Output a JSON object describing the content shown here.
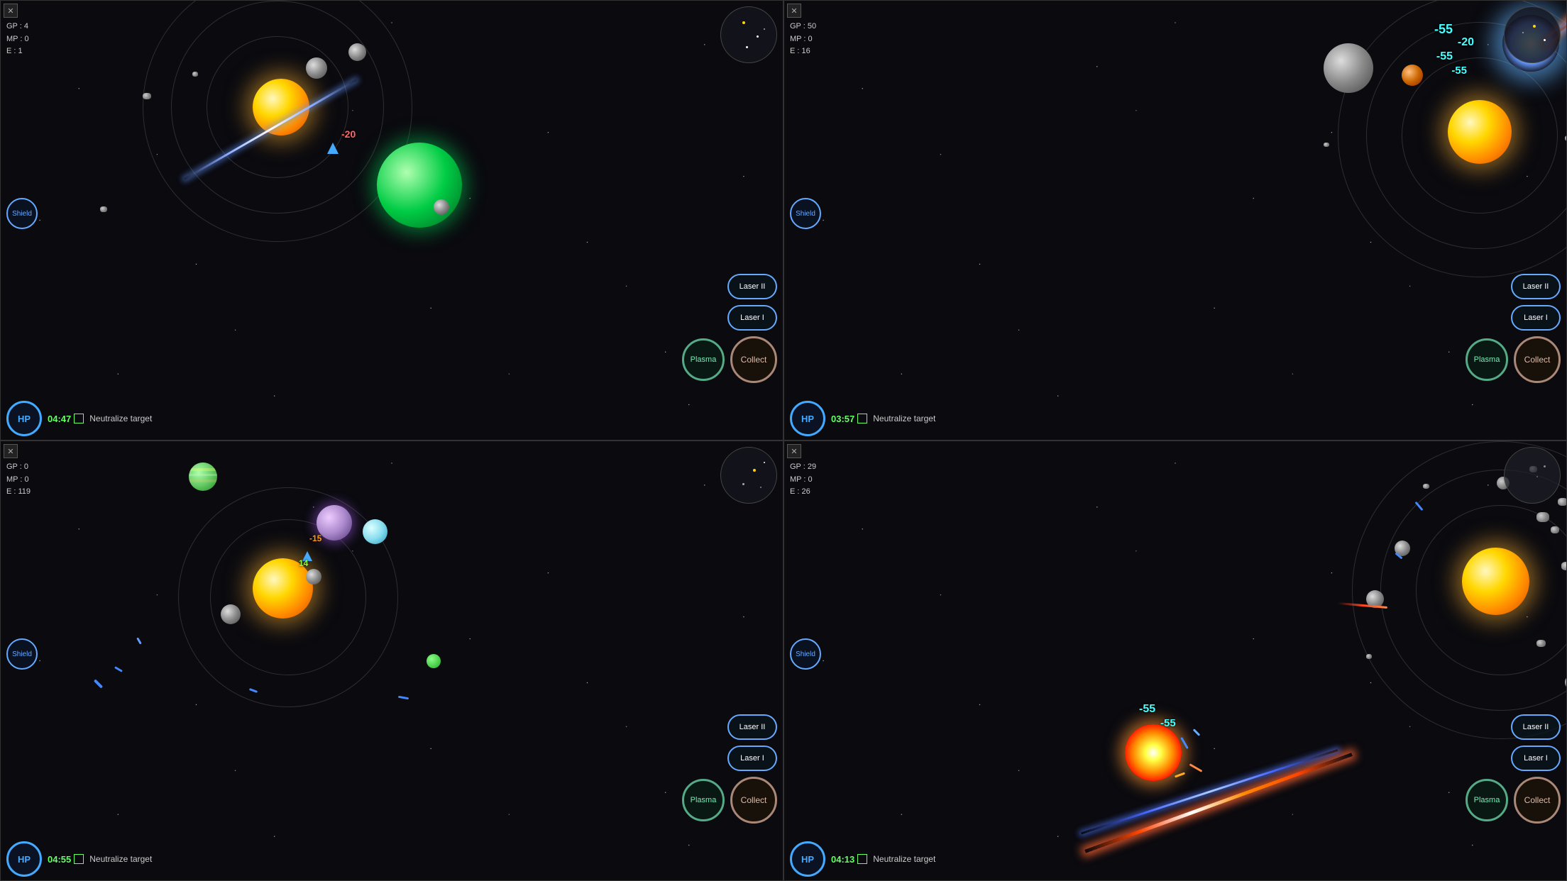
{
  "panels": [
    {
      "id": "panel-tl",
      "position": "top-left",
      "stats": {
        "gp": "GP : 4",
        "mp": "MP : 0",
        "e": "E : 1"
      },
      "timer": "04:47",
      "objective": "Neutralize target",
      "hp_label": "HP",
      "shield_label": "Shield",
      "buttons": {
        "laser2": "Laser II",
        "laser1": "Laser I",
        "plasma": "Plasma",
        "collect": "Collect"
      }
    },
    {
      "id": "panel-tr",
      "position": "top-right",
      "stats": {
        "gp": "GP : 50",
        "mp": "MP : 0",
        "e": "E : 16"
      },
      "timer": "03:57",
      "objective": "Neutralize target",
      "hp_label": "HP",
      "shield_label": "Shield",
      "buttons": {
        "laser2": "Laser II",
        "laser1": "Laser I",
        "plasma": "Plasma",
        "collect": "Collect"
      },
      "damage_numbers": [
        "-55",
        "-20",
        "-55",
        "-55"
      ]
    },
    {
      "id": "panel-bl",
      "position": "bottom-left",
      "stats": {
        "gp": "GP : 0",
        "mp": "MP : 0",
        "e": "E : 119"
      },
      "timer": "04:55",
      "objective": "Neutralize target",
      "hp_label": "HP",
      "shield_label": "Shield",
      "buttons": {
        "laser2": "Laser II",
        "laser1": "Laser I",
        "plasma": "Plasma",
        "collect": "Collect"
      }
    },
    {
      "id": "panel-br",
      "position": "bottom-right",
      "stats": {
        "gp": "GP : 29",
        "mp": "MP : 0",
        "e": "E : 26"
      },
      "timer": "04:13",
      "objective": "Neutralize target",
      "hp_label": "HP",
      "shield_label": "Shield",
      "buttons": {
        "laser2": "Laser II",
        "laser1": "Laser I",
        "plasma": "Plasma",
        "collect": "Collect"
      },
      "damage_numbers": [
        "-55",
        "-55"
      ]
    }
  ],
  "icons": {
    "close": "✕",
    "checkbox": "□"
  }
}
